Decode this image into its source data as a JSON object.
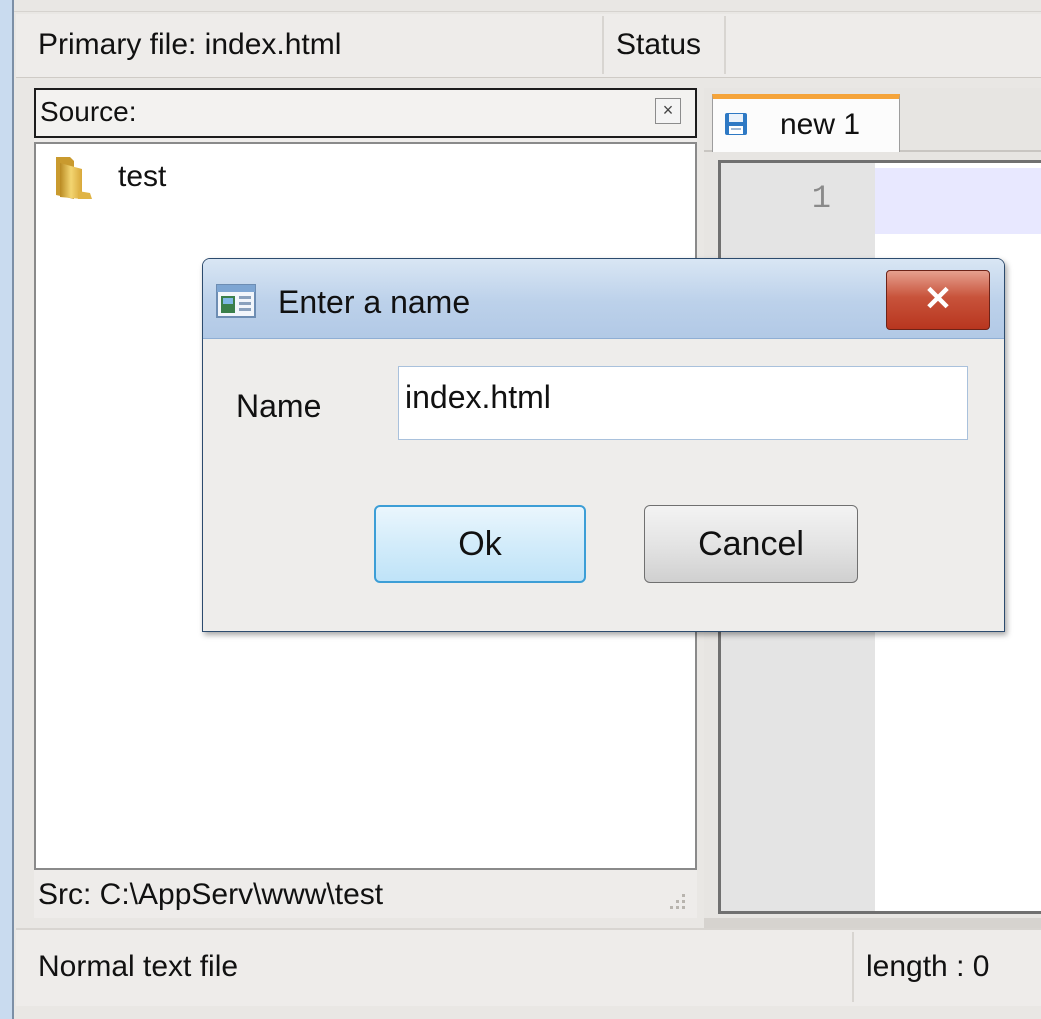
{
  "topbar": {
    "primary_file": "Primary file: index.html",
    "status": "Status"
  },
  "source_panel": {
    "header_label": "Source:",
    "close_glyph": "×",
    "tree_items": [
      {
        "label": "test",
        "icon": "folder-icon"
      }
    ],
    "src_path": "Src: C:\\AppServ\\www\\test"
  },
  "editor": {
    "tab_label": "new 1",
    "tab_icon": "save-icon",
    "tab_accent_color": "#f5a43a",
    "line_numbers": [
      "1"
    ],
    "current_line_color": "#e8e8ff"
  },
  "statusbar": {
    "file_type": "Normal text file",
    "length": "length : 0"
  },
  "dialog": {
    "title": "Enter a name",
    "close_glyph": "✕",
    "name_label": "Name",
    "name_value": "index.html",
    "ok_label": "Ok",
    "cancel_label": "Cancel"
  }
}
